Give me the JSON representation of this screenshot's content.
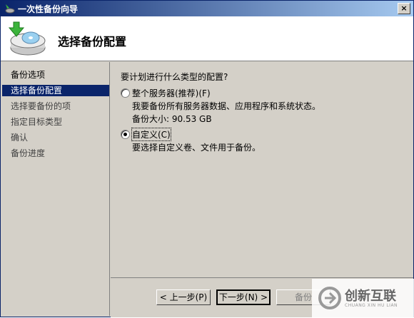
{
  "window": {
    "title": "一次性备份向导",
    "close_label": "×"
  },
  "header": {
    "title": "选择备份配置"
  },
  "sidebar": {
    "items": [
      {
        "label": "备份选项",
        "state": "normal"
      },
      {
        "label": "选择备份配置",
        "state": "active"
      },
      {
        "label": "选择要备份的项",
        "state": "disabled"
      },
      {
        "label": "指定目标类型",
        "state": "disabled"
      },
      {
        "label": "确认",
        "state": "disabled"
      },
      {
        "label": "备份进度",
        "state": "disabled"
      }
    ]
  },
  "main": {
    "question": "要计划进行什么类型的配置?",
    "options": [
      {
        "label": "整个服务器(推荐)(F)",
        "desc": "我要备份所有服务器数据、应用程序和系统状态。",
        "size": "备份大小: 90.53 GB",
        "checked": false
      },
      {
        "label": "自定义(C)",
        "desc": "要选择自定义卷、文件用于备份。",
        "checked": true
      }
    ]
  },
  "footer": {
    "prev": "< 上一步(P)",
    "next": "下一步(N) >",
    "backup": "备份"
  },
  "watermark": {
    "text": "创新互联",
    "sub": "CHUANG XIN HU LIAN"
  },
  "colors": {
    "title_start": "#0a246a",
    "title_end": "#a6caf0",
    "selection": "#0a246a",
    "face": "#d4d0c8"
  }
}
